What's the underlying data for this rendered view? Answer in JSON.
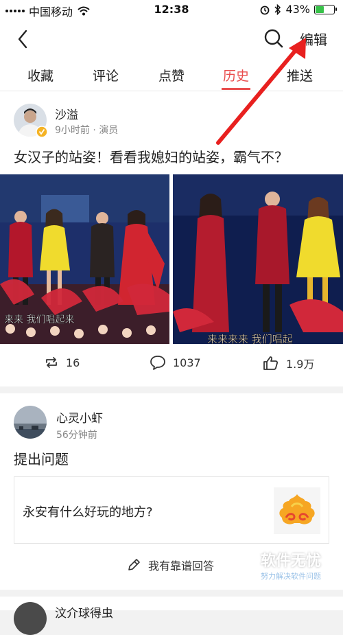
{
  "status_bar": {
    "carrier": "中国移动",
    "time": "12:38",
    "battery_percent": "43%",
    "battery_level": 0.43,
    "battery_color": "#38c24a"
  },
  "nav": {
    "back_icon": "chevron-left-icon",
    "search_icon": "search-icon",
    "edit_label": "编辑"
  },
  "tabs": [
    {
      "label": "收藏"
    },
    {
      "label": "评论"
    },
    {
      "label": "点赞"
    },
    {
      "label": "历史",
      "active": true
    },
    {
      "label": "推送"
    }
  ],
  "accent_color": "#e94e4e",
  "feed": [
    {
      "author": "沙溢",
      "meta": "9小时前 · 演员",
      "text": "女汉子的站姿！看看我媳妇的站姿，霸气不？",
      "image_captions": [
        "来来 我们唱起来",
        "来来来来 我们唱起"
      ],
      "reposts": "16",
      "comments": "1037",
      "likes": "1.9万"
    },
    {
      "author": "心灵小虾",
      "meta": "56分钟前",
      "type_label": "提出问题",
      "question": "永安有什么好玩的地方?",
      "answer_label": "我有靠谱回答"
    },
    {
      "author": "汶介球得虫"
    }
  ],
  "watermark": {
    "title": "软件无忧",
    "subtitle": "努力解决软件问题"
  }
}
